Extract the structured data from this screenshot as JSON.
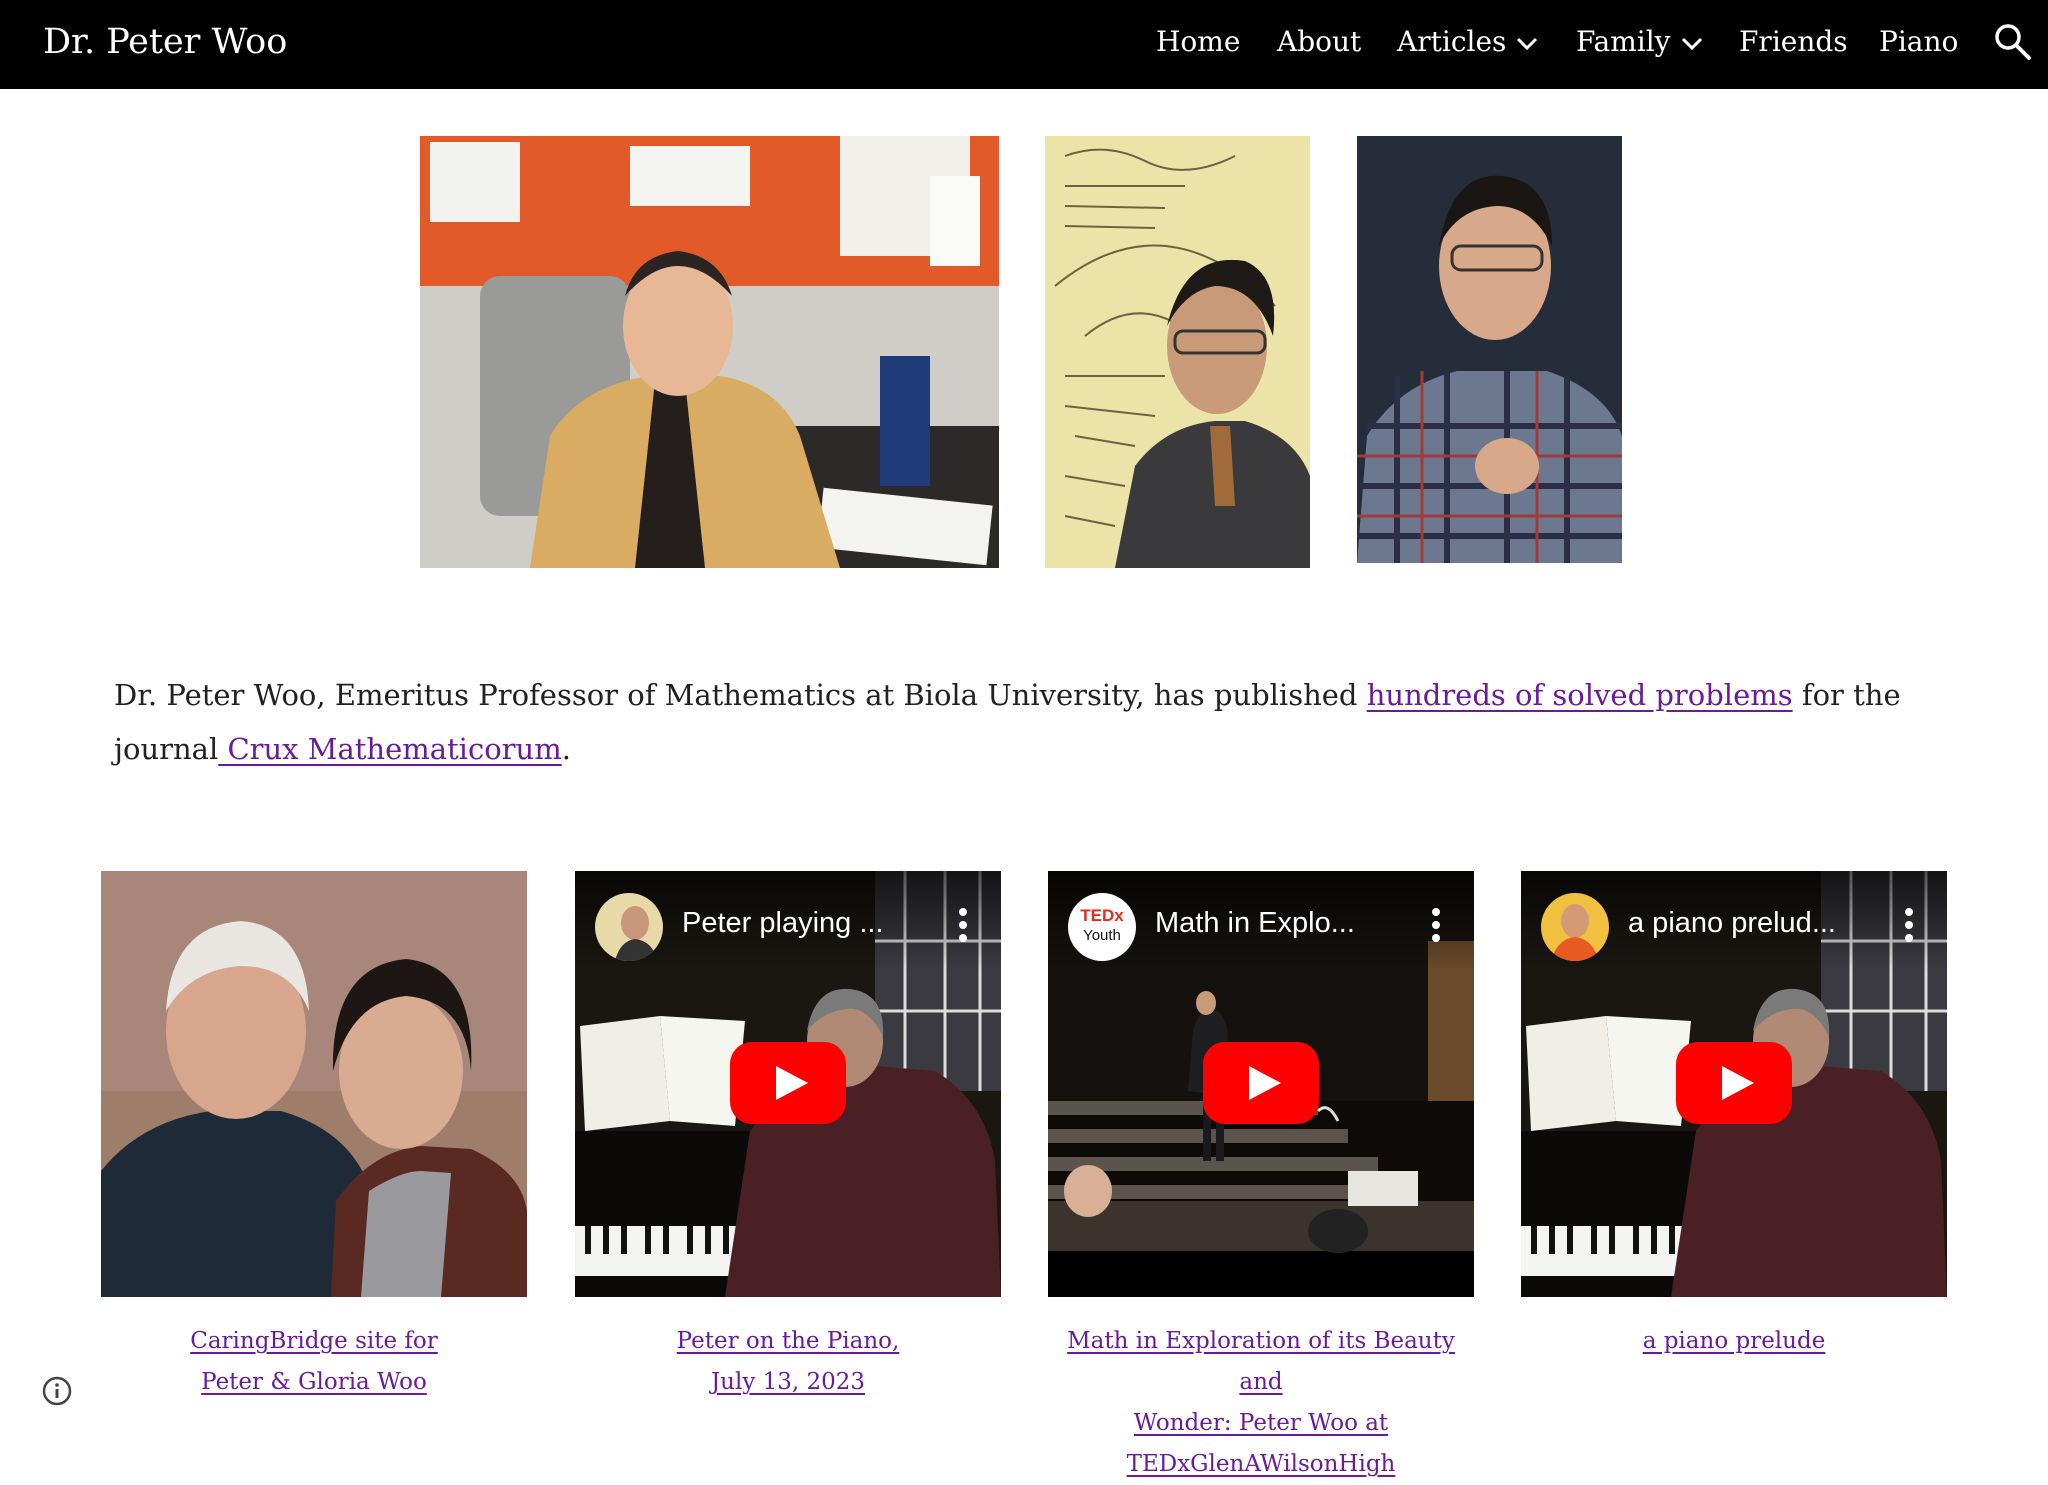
{
  "site": {
    "title": "Dr. Peter Woo"
  },
  "nav": {
    "items": [
      {
        "label": "Home"
      },
      {
        "label": "About"
      },
      {
        "label": "Articles"
      },
      {
        "label": "Family"
      },
      {
        "label": "Friends"
      },
      {
        "label": "Piano"
      }
    ],
    "search_icon": "search-icon"
  },
  "intro": {
    "text_before": "Dr. Peter Woo, Emeritus Professor of Mathematics at Biola University, has published ",
    "link1": "hundreds of solved problems",
    "text_middle": " for the journal",
    "link2": " Crux Mathematicorum",
    "text_after": "."
  },
  "cards": [
    {
      "type": "image",
      "caption_line1": " CaringBridge site for",
      "caption_line2": "Peter & Gloria Woo"
    },
    {
      "type": "video",
      "video_title": "Peter playing ...",
      "caption_line1": "Peter on the Piano,",
      "caption_line2": "July 13, 2023"
    },
    {
      "type": "video",
      "video_title": "Math in Explo...",
      "channel_badge_top": "TEDx",
      "channel_badge_bottom": "Youth",
      "caption_line1": "Math in Exploration of its Beauty and",
      "caption_line2": "Wonder: Peter Woo at",
      "caption_line3": "TEDxGlenAWilsonHigh"
    },
    {
      "type": "video",
      "video_title": "a piano prelud...",
      "caption_line1": "a piano prelude"
    }
  ],
  "colors": {
    "header_bg": "#000000",
    "link": "#6a1b9a",
    "youtube_red": "#ff0000"
  },
  "icons": [
    "search-icon",
    "chevron-down-icon",
    "play-icon",
    "more-vert-icon",
    "info-icon"
  ]
}
